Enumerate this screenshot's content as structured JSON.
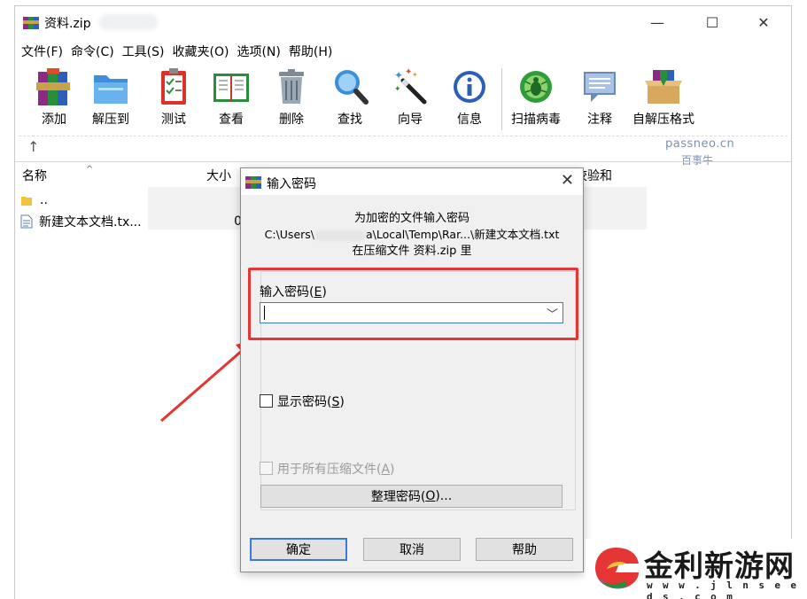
{
  "window": {
    "title": "资料.zip",
    "controls": {
      "minimize": "—",
      "maximize": "☐",
      "close": "✕"
    }
  },
  "menu": [
    "文件(F)",
    "命令(C)",
    "工具(S)",
    "收藏夹(O)",
    "选项(N)",
    "帮助(H)"
  ],
  "toolbar": [
    {
      "label": "添加",
      "icon": "add-archive-icon"
    },
    {
      "label": "解压到",
      "icon": "extract-to-icon"
    },
    {
      "label": "测试",
      "icon": "test-icon"
    },
    {
      "label": "查看",
      "icon": "view-icon"
    },
    {
      "label": "删除",
      "icon": "delete-icon"
    },
    {
      "label": "查找",
      "icon": "find-icon"
    },
    {
      "label": "向导",
      "icon": "wizard-icon"
    },
    {
      "label": "信息",
      "icon": "info-icon"
    },
    {
      "label": "扫描病毒",
      "icon": "virus-scan-icon"
    },
    {
      "label": "注释",
      "icon": "comment-icon"
    },
    {
      "label": "自解压格式",
      "icon": "sfx-icon"
    }
  ],
  "addressbar": {
    "up": "↑"
  },
  "watermark": {
    "url": "passneo.cn",
    "name": "百事牛"
  },
  "filelist": {
    "columns": {
      "name": "名称",
      "size": "大小",
      "checksum": "校验和"
    },
    "rows": [
      {
        "name": "..",
        "size": ""
      },
      {
        "name": "新建文本文档.tx...",
        "size": "0"
      }
    ]
  },
  "dialog": {
    "title": "输入密码",
    "close": "✕",
    "line1": "为加密的文件输入密码",
    "line2": "C:\\Users\\",
    "line2_tail": "a\\Local\\Temp\\Rar...\\新建文本文档.txt",
    "line3": "在压缩文件 资料.zip 里",
    "password_label": "输入密码(",
    "password_key": "E",
    "password_value": "",
    "show_password_label": "显示密码(",
    "show_password_key": "S",
    "show_password_checked": false,
    "use_all_label": "用于所有压缩文件(",
    "use_all_key": "A",
    "use_all_checked": false,
    "organize_label": "整理密码(",
    "organize_key": "O",
    "organize_suffix": ")...",
    "ok": "确定",
    "cancel": "取消",
    "help": "帮助"
  },
  "badge": {
    "name": "金利新游网",
    "url": "w w w . j l n s e e d s . c o m"
  },
  "colors": {
    "highlight": "#e53535",
    "focus": "#3a7bd5",
    "dialog_bg": "#f0f0f0",
    "watermark": "#7a8fb8"
  }
}
